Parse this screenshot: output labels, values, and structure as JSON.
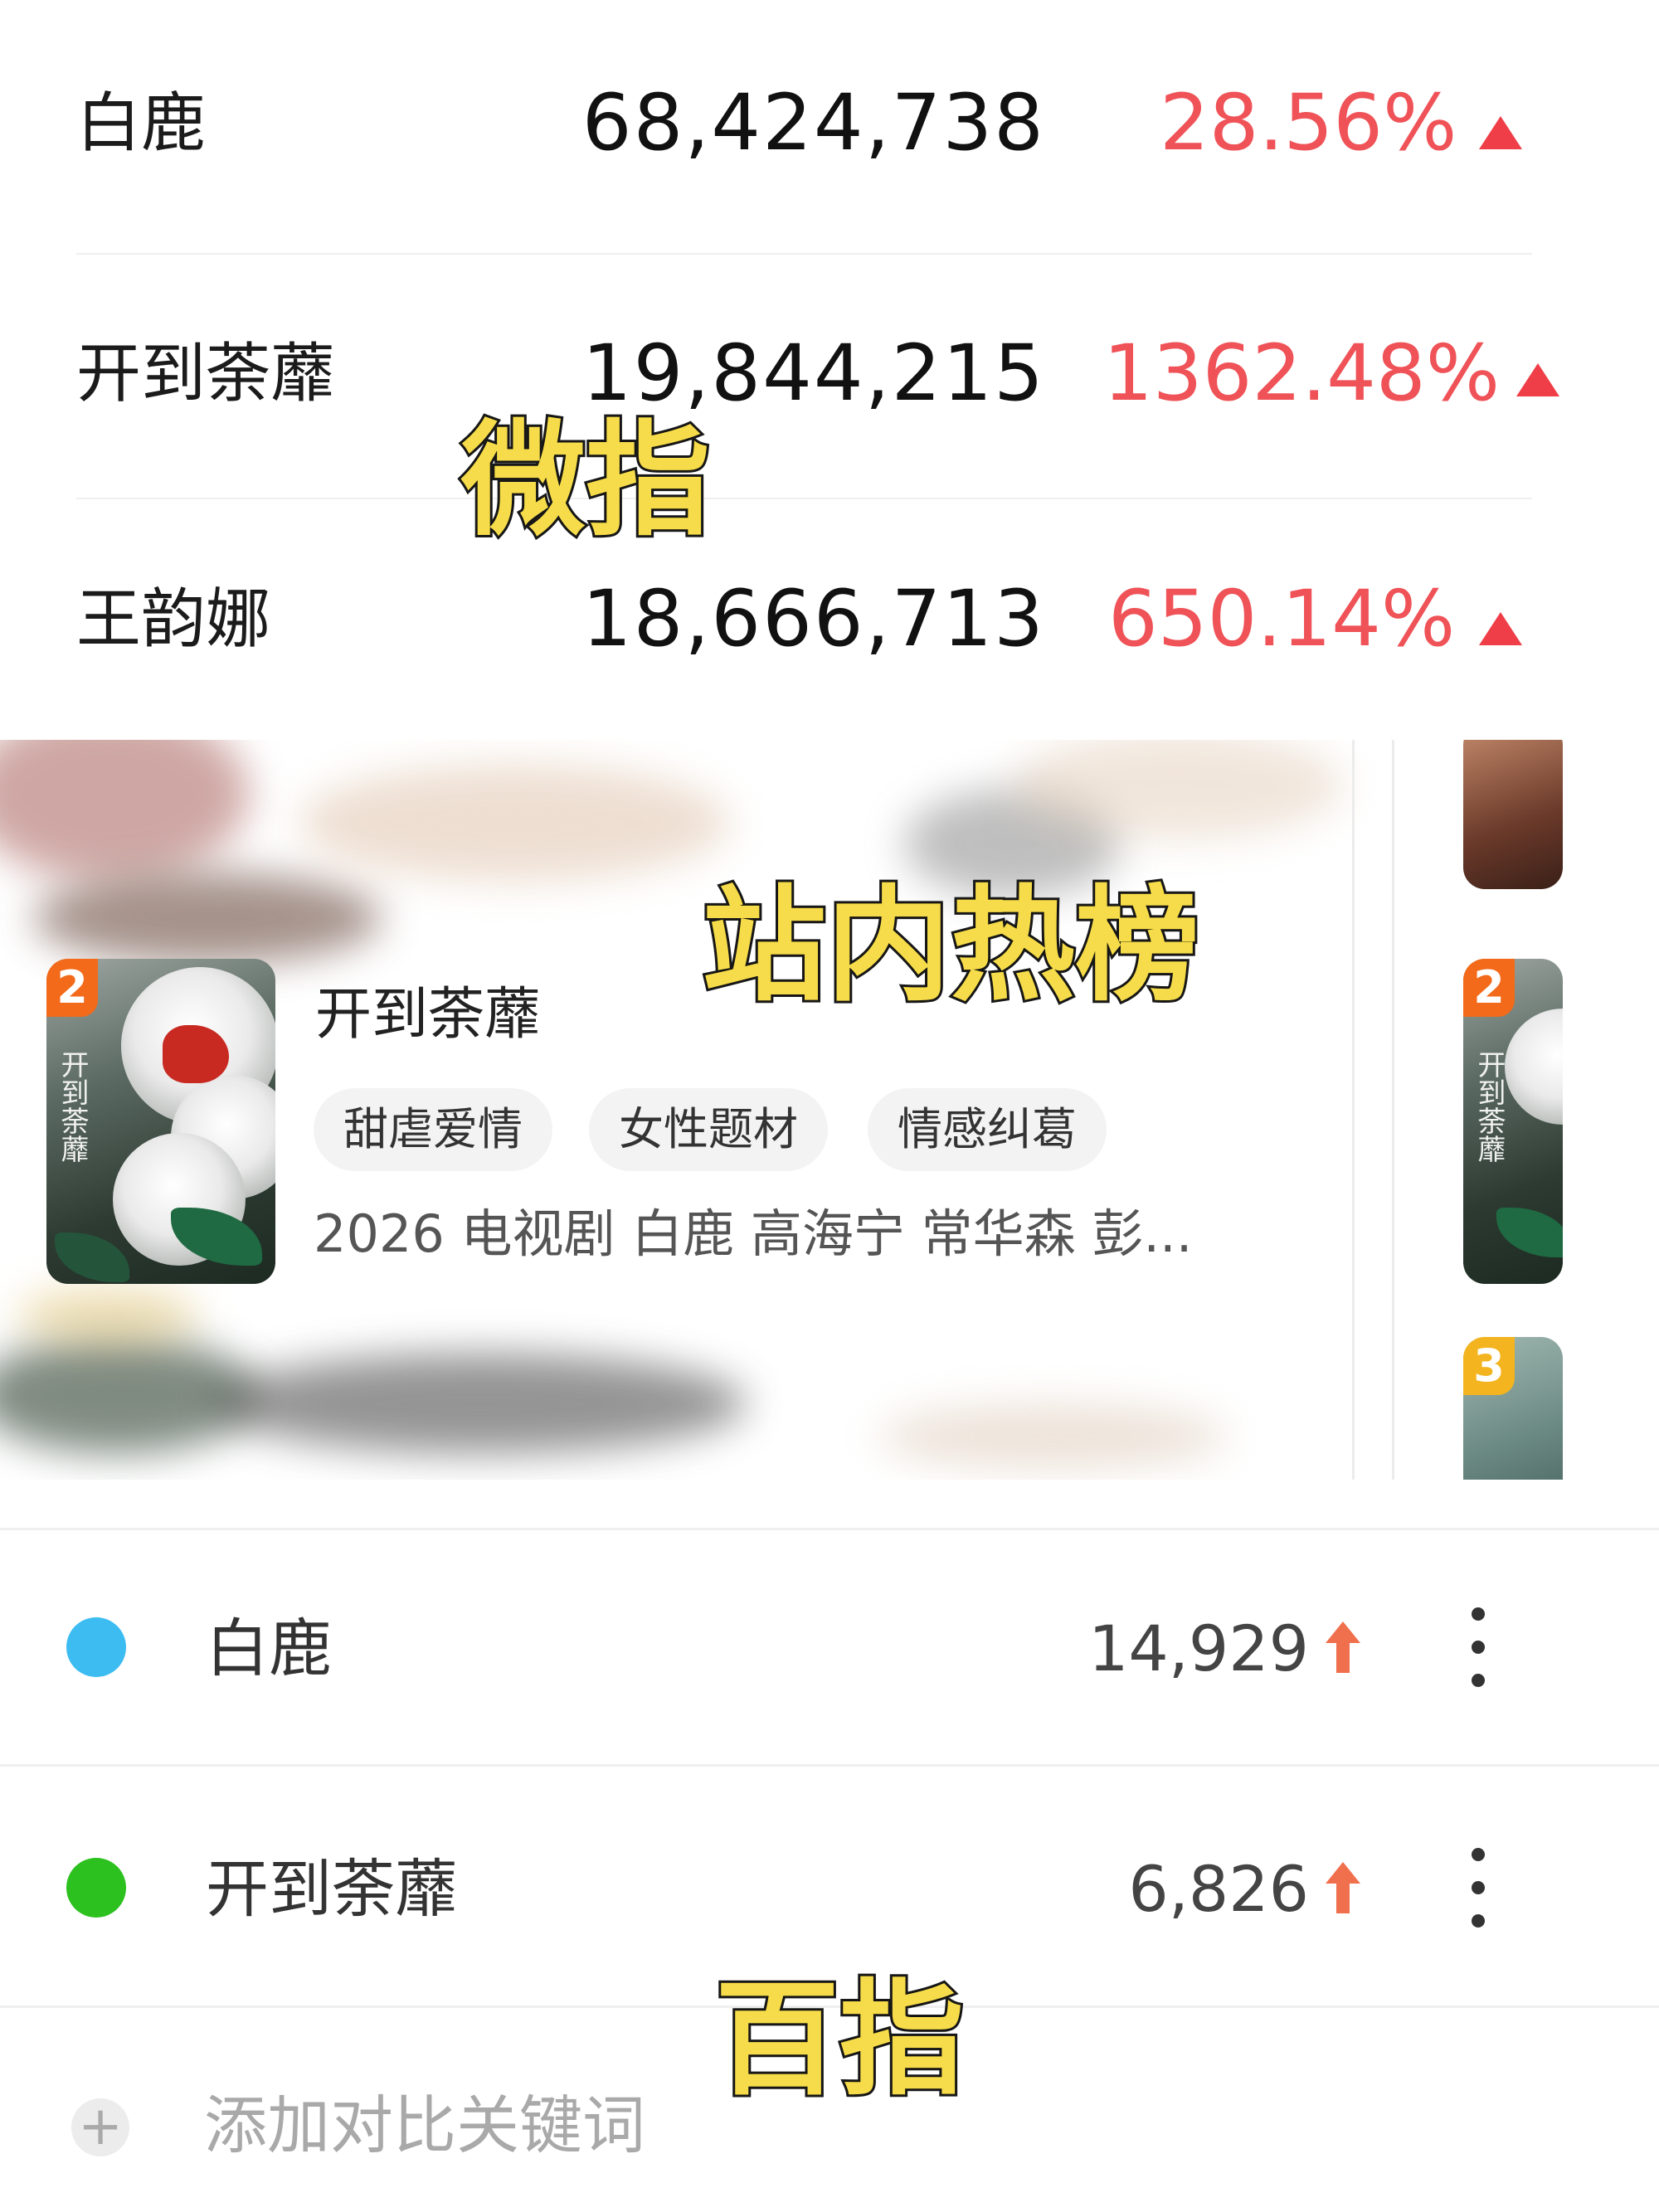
{
  "weizhi": {
    "caption": "微指",
    "rows": [
      {
        "name": "白鹿",
        "value": "68,424,738",
        "change": "28.56%",
        "trend": "up"
      },
      {
        "name": "开到荼蘼",
        "value": "19,844,215",
        "change": "1362.48%",
        "trend": "up"
      },
      {
        "name": "王韵娜",
        "value": "18,666,713",
        "change": "650.14%",
        "trend": "up"
      }
    ]
  },
  "hot_list": {
    "caption": "站内热榜",
    "item": {
      "rank": "2",
      "poster_text": "开到荼蘼",
      "title": "开到荼蘼",
      "tags": [
        "甜虐爱情",
        "女性题材",
        "情感纠葛"
      ],
      "meta": "2026 电视剧 白鹿 高海宁 常华森 彭..."
    },
    "side_ranks": [
      "2",
      "3"
    ]
  },
  "baizhi": {
    "caption": "百指",
    "rows": [
      {
        "name": "白鹿",
        "value": "14,929",
        "dot_color": "#3cbcf0",
        "trend": "up"
      },
      {
        "name": "开到荼蘼",
        "value": "6,826",
        "dot_color": "#2cc11e",
        "trend": "up"
      }
    ],
    "add_label": "添加对比关键词",
    "add_icon": "+"
  },
  "colors": {
    "up_red": "#ef5257",
    "arrow_orange": "#f0704d",
    "caption_yellow": "#f6dc4a"
  }
}
